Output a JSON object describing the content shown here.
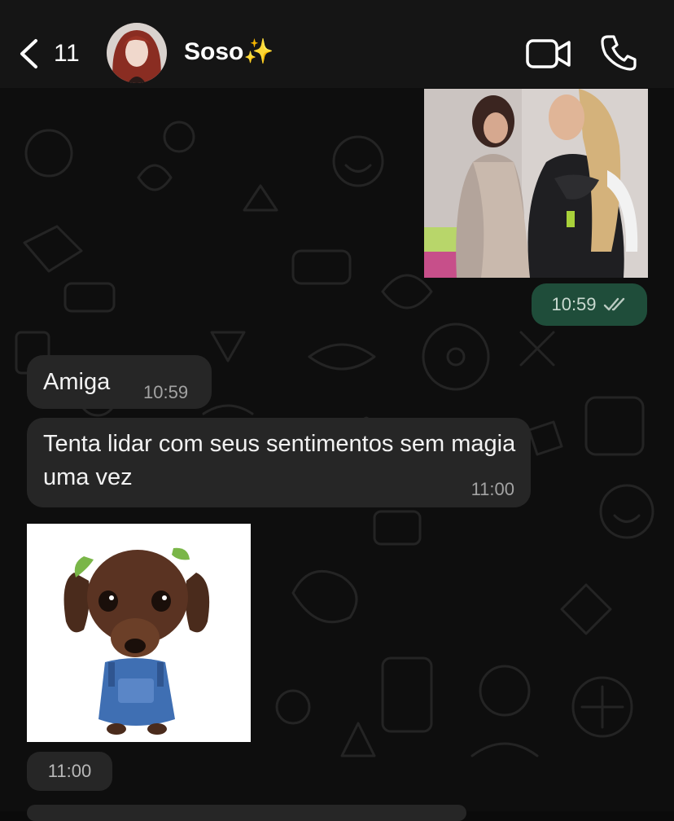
{
  "header": {
    "back_count": "11",
    "contact_name": "Soso",
    "contact_emoji": "✨",
    "icons": {
      "back": "chevron-left-icon",
      "video": "video-camera-icon",
      "call": "phone-icon"
    }
  },
  "messages": [
    {
      "type": "image",
      "direction": "outgoing",
      "description_icon": "photo"
    },
    {
      "type": "time-only",
      "direction": "outgoing",
      "time": "10:59",
      "status": "read"
    },
    {
      "type": "text",
      "direction": "incoming",
      "text": "Amiga",
      "time": "10:59"
    },
    {
      "type": "text",
      "direction": "incoming",
      "text": "Tenta lidar com seus sentimentos sem magia uma vez",
      "time": "11:00"
    },
    {
      "type": "sticker",
      "direction": "incoming"
    },
    {
      "type": "time-only",
      "direction": "incoming",
      "time": "11:00"
    }
  ],
  "colors": {
    "header_bg": "#151515",
    "chat_bg": "#0e0e0e",
    "incoming_bubble": "#262626",
    "outgoing_bubble": "#1f4d3a",
    "accent": "#f5c33b"
  }
}
